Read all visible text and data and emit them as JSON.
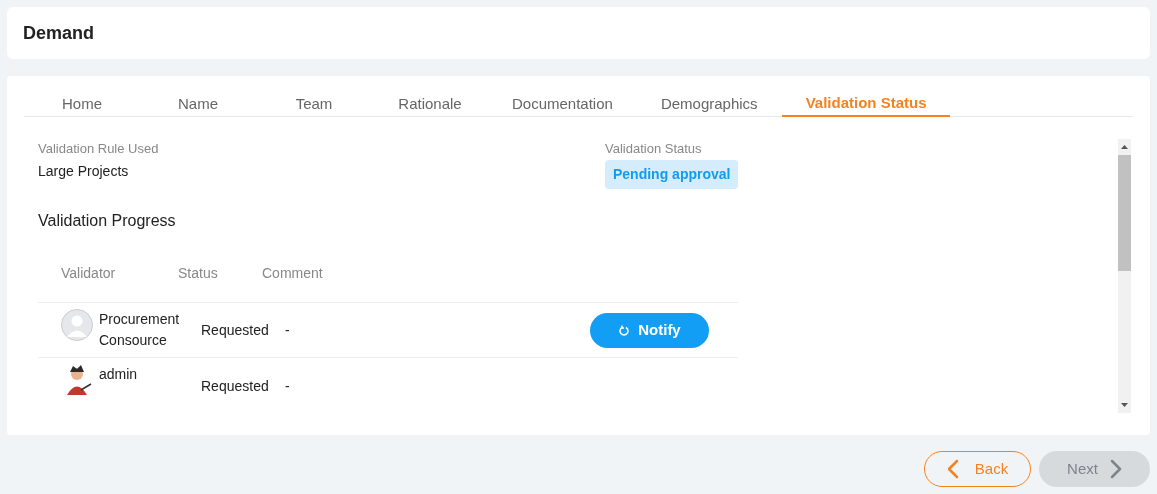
{
  "header": {
    "title": "Demand"
  },
  "tabs": [
    {
      "label": "Home",
      "selected": false
    },
    {
      "label": "Name",
      "selected": false
    },
    {
      "label": "Team",
      "selected": false
    },
    {
      "label": "Rationale",
      "selected": false
    },
    {
      "label": "Documentation",
      "selected": false
    },
    {
      "label": "Demographics",
      "selected": false
    },
    {
      "label": "Validation Status",
      "selected": true
    }
  ],
  "rule": {
    "label": "Validation Rule Used",
    "value": "Large Projects"
  },
  "status": {
    "label": "Validation Status",
    "badge": "Pending approval"
  },
  "progress": {
    "title": "Validation Progress",
    "columns": [
      "Validator",
      "Status",
      "Comment"
    ],
    "rows": [
      {
        "validator": "Procurement Consource",
        "kind": "placeholder",
        "status": "Requested",
        "comment": "-",
        "action": "Notify"
      },
      {
        "validator": "admin",
        "kind": "character",
        "status": "Requested",
        "comment": "-"
      }
    ]
  },
  "footer": {
    "back": {
      "label": "Back",
      "disabled": false
    },
    "next": {
      "label": "Next",
      "disabled": true
    }
  }
}
